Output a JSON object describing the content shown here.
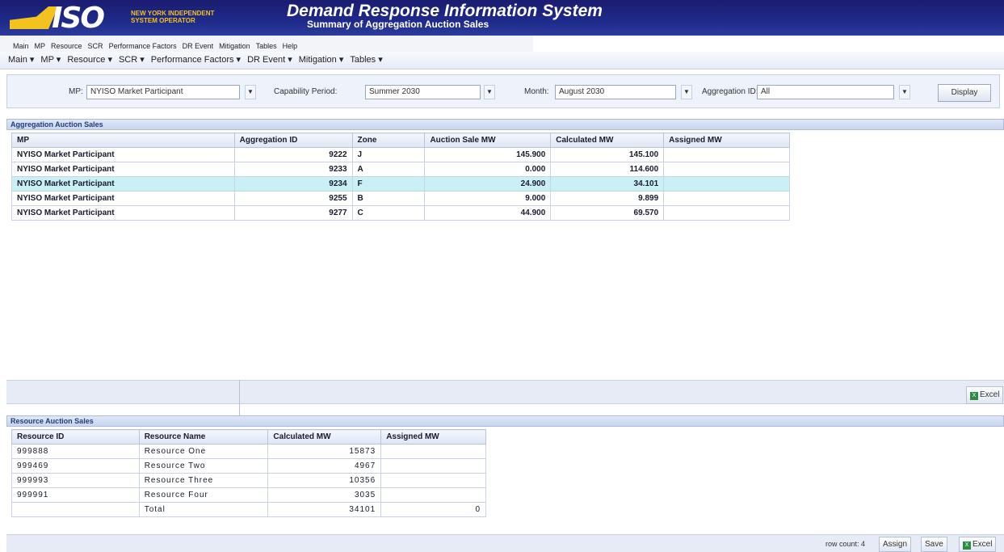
{
  "header": {
    "logo_text": "ISO",
    "org_name": "NEW YORK INDEPENDENT SYSTEM OPERATOR",
    "app_title": "Demand Response Information System",
    "sub_title": "Summary of Aggregation Auction Sales"
  },
  "old_menu": [
    "Main",
    "MP",
    "Resource",
    "SCR",
    "Performance Factors",
    "DR Event",
    "Mitigation",
    "Tables",
    "Help"
  ],
  "menu": [
    "Main ▾",
    "MP ▾",
    "Resource ▾",
    "SCR ▾",
    "Performance Factors ▾",
    "DR Event ▾",
    "Mitigation ▾",
    "Tables ▾"
  ],
  "filters": {
    "mp_label": "MP:",
    "mp_value": "NYISO Market Participant",
    "cap_label": "Capability Period:",
    "cap_value": "Summer 2030",
    "month_label": "Month:",
    "month_value": "August 2030",
    "agg_label": "Aggregation ID:",
    "agg_value": "All",
    "display_label": "Display"
  },
  "aggregation_panel": {
    "title": "Aggregation Auction Sales",
    "columns": [
      "MP",
      "Aggregation ID",
      "Zone",
      "Auction Sale MW",
      "Calculated MW",
      "Assigned MW"
    ],
    "rows": [
      {
        "mp": "NYISO Market Participant",
        "agg_id": "9222",
        "zone": "J",
        "sale": "145.900",
        "calc": "145.100",
        "assigned": ""
      },
      {
        "mp": "NYISO Market Participant",
        "agg_id": "9233",
        "zone": "A",
        "sale": "0.000",
        "calc": "114.600",
        "assigned": ""
      },
      {
        "mp": "NYISO Market Participant",
        "agg_id": "9234",
        "zone": "F",
        "sale": "24.900",
        "calc": "34.101",
        "assigned": ""
      },
      {
        "mp": "NYISO Market Participant",
        "agg_id": "9255",
        "zone": "B",
        "sale": "9.000",
        "calc": "9.899",
        "assigned": ""
      },
      {
        "mp": "NYISO Market Participant",
        "agg_id": "9277",
        "zone": "C",
        "sale": "44.900",
        "calc": "69.570",
        "assigned": ""
      }
    ],
    "highlighted_row": 2,
    "excel_label": "Excel"
  },
  "resource_panel": {
    "title": "Resource Auction Sales",
    "columns": [
      "Resource ID",
      "Resource Name",
      "Calculated MW",
      "Assigned MW"
    ],
    "rows": [
      {
        "id": "999888",
        "name": "Resource One",
        "calc": "15873",
        "assigned": ""
      },
      {
        "id": "999469",
        "name": "Resource Two",
        "calc": "4967",
        "assigned": ""
      },
      {
        "id": "999993",
        "name": "Resource Three",
        "calc": "10356",
        "assigned": ""
      },
      {
        "id": "999991",
        "name": "Resource Four",
        "calc": "3035",
        "assigned": ""
      }
    ],
    "total": {
      "label": "Total",
      "calc": "34101",
      "assigned": "0"
    }
  },
  "footer": {
    "row_count_label": "row count: 4",
    "assign_label": "Assign",
    "save_label": "Save",
    "excel_label": "Excel"
  },
  "colors": {
    "header_bg": "#1e2a8a",
    "logo_yellow": "#f3c21f",
    "highlight_row": "#c9f1f4",
    "panel_bg": "#e6ebf6"
  }
}
